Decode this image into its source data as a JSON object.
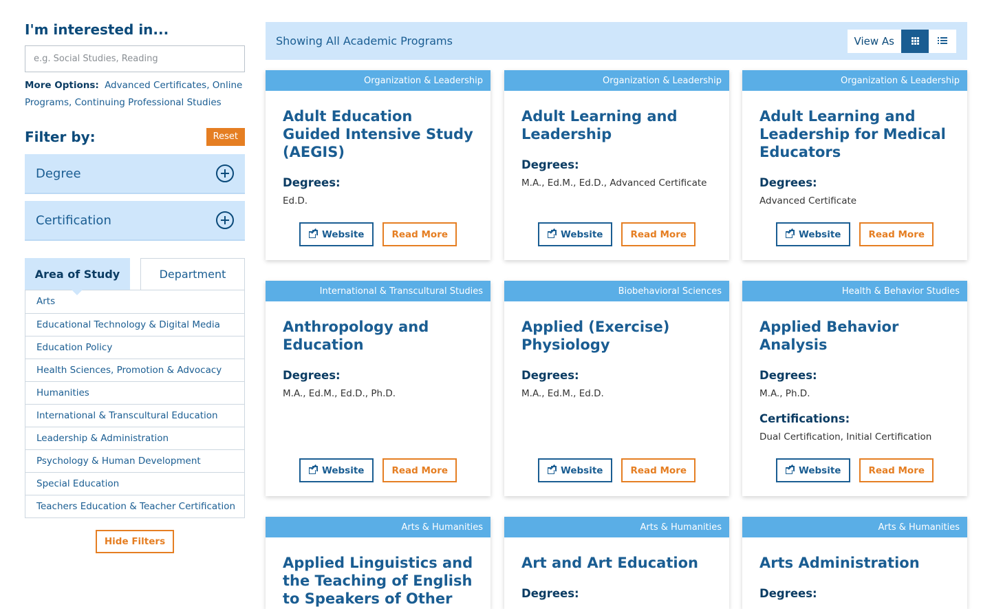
{
  "sidebar": {
    "interest_title": "I'm interested in...",
    "search_placeholder": "e.g. Social Studies, Reading",
    "more_options_label": "More Options:",
    "more_options_links": [
      "Advanced Certificates",
      "Online Programs",
      "Continuing Professional Studies"
    ],
    "filter_title": "Filter by:",
    "reset_label": "Reset",
    "accordions": [
      "Degree",
      "Certification"
    ],
    "tabs": [
      "Area of Study",
      "Department"
    ],
    "areas": [
      "Arts",
      "Educational Technology & Digital Media",
      "Education Policy",
      "Health Sciences, Promotion & Advocacy",
      "Humanities",
      "International & Transcultural Education",
      "Leadership & Administration",
      "Psychology & Human Development",
      "Special Education",
      "Teachers Education & Teacher Certification"
    ],
    "hide_filters_label": "Hide Filters"
  },
  "topbar": {
    "showing": "Showing All Academic Programs",
    "view_as": "View As"
  },
  "cards": {
    "degrees_heading": "Degrees:",
    "certifications_heading": "Certifications:",
    "website_label": "Website",
    "read_more_label": "Read More",
    "items": [
      {
        "tag": "Organization & Leadership",
        "title": "Adult Education Guided Intensive Study (AEGIS)",
        "degrees": "Ed.D."
      },
      {
        "tag": "Organization & Leadership",
        "title": "Adult Learning and Leadership",
        "degrees": "M.A., Ed.M., Ed.D., Advanced Certificate"
      },
      {
        "tag": "Organization & Leadership",
        "title": "Adult Learning and Leadership for Medical Educators",
        "degrees": "Advanced Certificate"
      },
      {
        "tag": "International & Transcultural Studies",
        "title": "Anthropology and Education",
        "degrees": "M.A., Ed.M., Ed.D., Ph.D."
      },
      {
        "tag": "Biobehavioral Sciences",
        "title": "Applied (Exercise) Physiology",
        "degrees": "M.A., Ed.M., Ed.D."
      },
      {
        "tag": "Health & Behavior Studies",
        "title": "Applied Behavior Analysis",
        "degrees": "M.A., Ph.D.",
        "certifications": "Dual Certification, Initial Certification"
      },
      {
        "tag": "Arts & Humanities",
        "title": "Applied Linguistics and the Teaching of English to Speakers of Other"
      },
      {
        "tag": "Arts & Humanities",
        "title": "Art and Art Education"
      },
      {
        "tag": "Arts & Humanities",
        "title": "Arts Administration"
      }
    ]
  }
}
